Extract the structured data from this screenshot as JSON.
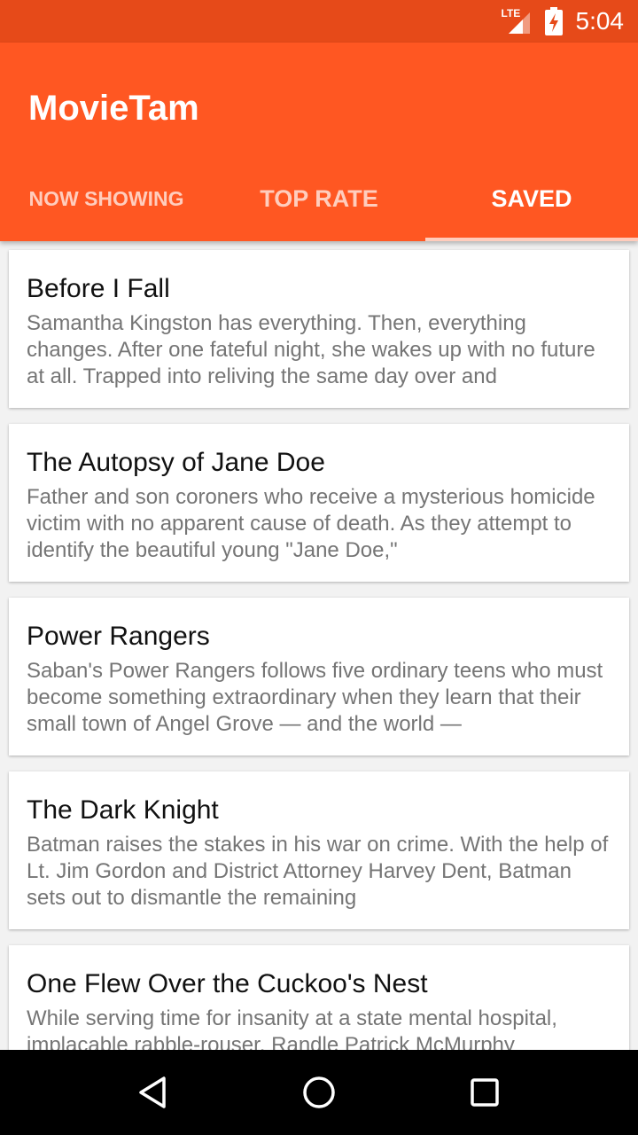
{
  "status_bar": {
    "network": "LTE",
    "time": "5:04"
  },
  "app": {
    "title": "MovieTam",
    "accent": "#ff5722",
    "status_color": "#e64a19"
  },
  "tabs": [
    {
      "label": "NOW SHOWING",
      "active": false
    },
    {
      "label": "TOP RATE",
      "active": false
    },
    {
      "label": "SAVED",
      "active": true
    }
  ],
  "movies": [
    {
      "title": "Before I Fall",
      "overview": "Samantha Kingston has everything. Then, everything changes. After one fateful night, she wakes up with no future at all. Trapped into reliving the same day over and"
    },
    {
      "title": "The Autopsy of Jane Doe",
      "overview": "Father and son coroners who receive a mysterious homicide victim with no apparent cause of death. As they attempt to identify the beautiful young \"Jane Doe,\""
    },
    {
      "title": "Power Rangers",
      "overview": "Saban's Power Rangers follows five ordinary teens who must become something extraordinary when they learn that their small town of Angel Grove — and the world —"
    },
    {
      "title": "The Dark Knight",
      "overview": "Batman raises the stakes in his war on crime. With the help of Lt. Jim Gordon and District Attorney Harvey Dent, Batman sets out to dismantle the remaining"
    },
    {
      "title": "One Flew Over the Cuckoo's Nest",
      "overview": "While serving time for insanity at a state mental hospital, implacable rabble-rouser, Randle Patrick McMurphy"
    }
  ],
  "nav": {
    "back_icon": "back-triangle-icon",
    "home_icon": "home-circle-icon",
    "recents_icon": "recents-square-icon"
  }
}
